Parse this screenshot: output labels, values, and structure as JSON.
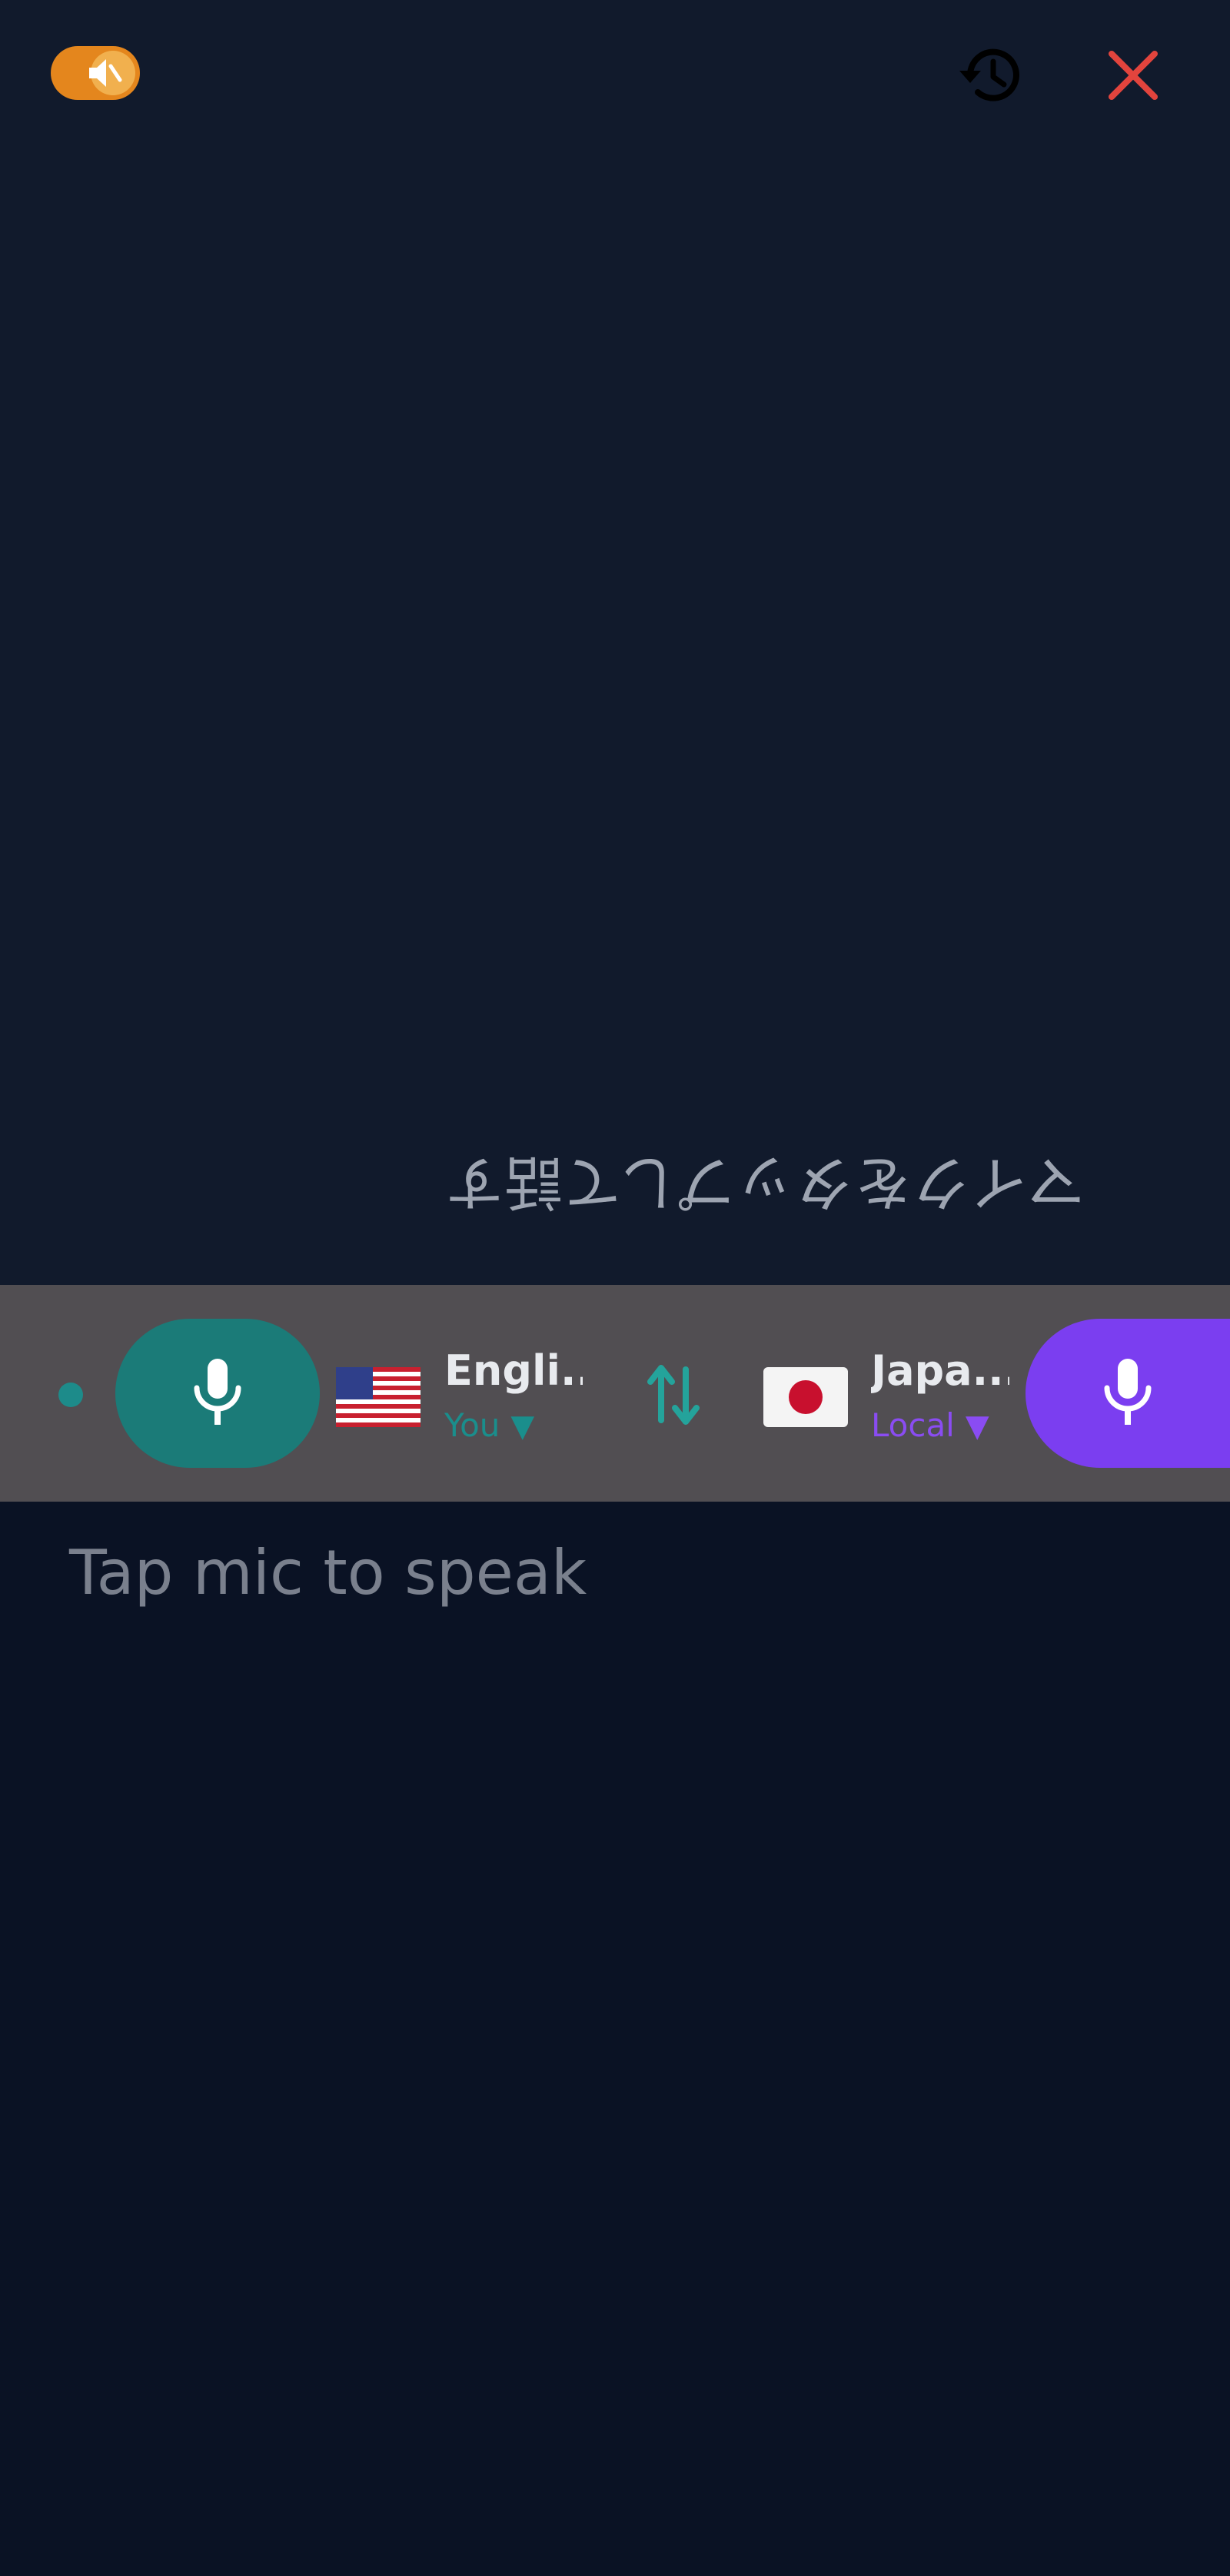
{
  "top_bar": {
    "speaker_toggle_icon": "speaker-muted-icon",
    "history_icon": "history-icon",
    "close_icon": "close-icon"
  },
  "partner_prompt": "マイクをタップして話す",
  "control_bar": {
    "left_language": {
      "flag_icon": "us-flag-icon",
      "name": "Engli...",
      "role": "You",
      "role_arrow": "▼"
    },
    "right_language": {
      "flag_icon": "japan-flag-icon",
      "name": "Japa...",
      "role": "Local",
      "role_arrow": "▼"
    },
    "swap_icon": "swap-arrows-icon",
    "mic_icon": "microphone-icon"
  },
  "user_prompt": "Tap mic to speak",
  "colors": {
    "accent_orange": "#e4861d",
    "close_red": "#e2443d",
    "teal": "#1b7b78",
    "purple": "#7b3ef0",
    "bar_gray": "#514e52",
    "top_background": "#111a2c",
    "bottom_background": "#0a1224"
  }
}
